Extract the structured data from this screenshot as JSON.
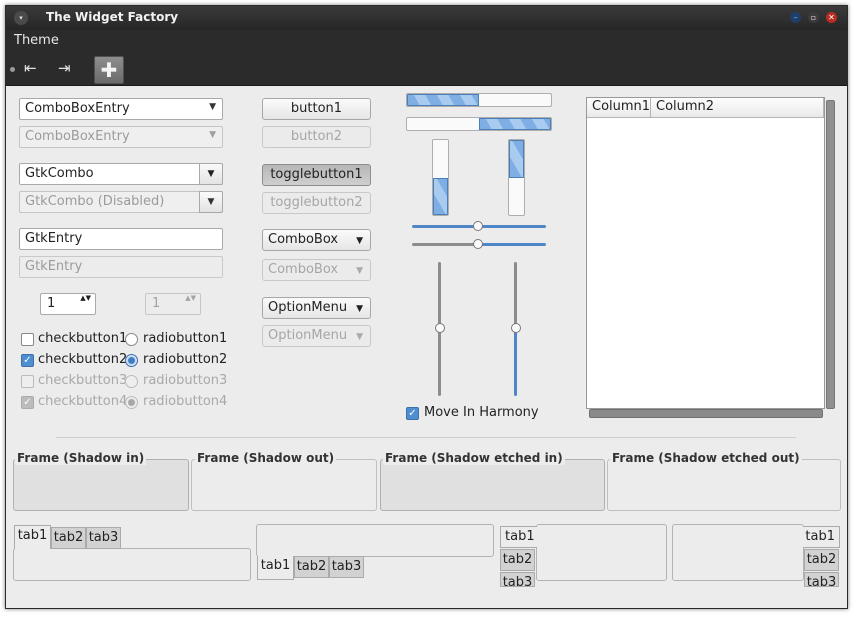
{
  "window": {
    "title": "The Widget Factory",
    "menu_btn_glyph": "▾",
    "min_glyph": "–",
    "max_glyph": "▫",
    "close_glyph": "✕"
  },
  "menubar": {
    "items": [
      "Theme"
    ]
  },
  "toolbar": {
    "icons": [
      "goto-first-icon",
      "goto-last-icon",
      "add-icon"
    ],
    "first_glyph": "⇤",
    "last_glyph": "⇥",
    "add_glyph": "✚"
  },
  "col1": {
    "comboboxentry": "ComboBoxEntry",
    "comboboxentry_disabled": "ComboBoxEntry",
    "gtkcombo": "GtkCombo",
    "gtkcombo_disabled": "GtkCombo (Disabled)",
    "entry": "GtkEntry",
    "entry_disabled": "GtkEntry",
    "spin1": "1",
    "spin2": "1",
    "arrow": "▼",
    "spin_arrows": "▲▼",
    "check_glyph": "✓",
    "checks": [
      "checkbutton1",
      "checkbutton2",
      "checkbutton3",
      "checkbutton4"
    ],
    "radios": [
      "radiobutton1",
      "radiobutton2",
      "radiobutton3",
      "radiobutton4"
    ]
  },
  "col2": {
    "button1": "button1",
    "button2": "button2",
    "togglebutton1": "togglebutton1",
    "togglebutton2": "togglebutton2",
    "combobox": "ComboBox",
    "combobox_disabled": "ComboBox",
    "optionmenu": "OptionMenu",
    "optionmenu_disabled": "OptionMenu"
  },
  "col3": {
    "move_in_harmony": "Move In Harmony",
    "progress": {
      "hbar1": 0.5,
      "hbar2": 0.5,
      "vbar1": 0.5,
      "vbar2": 0.5
    },
    "scales": {
      "hscale1": 0.5,
      "hscale2": 0.5,
      "vscale1": 0.5,
      "vscale2": 0.5
    }
  },
  "treeview": {
    "columns": [
      "Column1",
      "Column2"
    ]
  },
  "frames": [
    "Frame (Shadow in)",
    "Frame (Shadow out)",
    "Frame (Shadow etched in)",
    "Frame (Shadow etched out)"
  ],
  "notebooks": {
    "tabs": [
      "tab1",
      "tab2",
      "tab3"
    ]
  },
  "colors": {
    "accent": "#4f8fd1",
    "titlebar": "#2b2b2b",
    "window_bg": "#ececec"
  }
}
